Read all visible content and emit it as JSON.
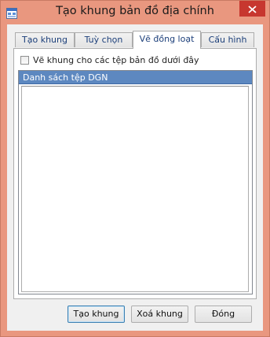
{
  "window": {
    "title": "Tạo khung bản đồ địa chính",
    "icon": "app-window-icon",
    "close_icon": "close-icon",
    "frame_color": "#e9977f",
    "close_color": "#c7372f"
  },
  "tabs": [
    {
      "label": "Tạo khung",
      "active": false
    },
    {
      "label": "Tuỳ chọn",
      "active": false
    },
    {
      "label": "Vẽ đồng loạt",
      "active": true
    },
    {
      "label": "Cấu hình",
      "active": false
    }
  ],
  "tab_page": {
    "checkbox": {
      "label": "Vẽ khung cho các tệp bản đồ dưới đây",
      "checked": false
    },
    "list": {
      "header": "Danh sách tệp DGN",
      "header_color": "#5d88c0",
      "items": []
    }
  },
  "buttons": {
    "create": "Tạo khung",
    "delete": "Xoá khung",
    "close": "Đóng"
  }
}
